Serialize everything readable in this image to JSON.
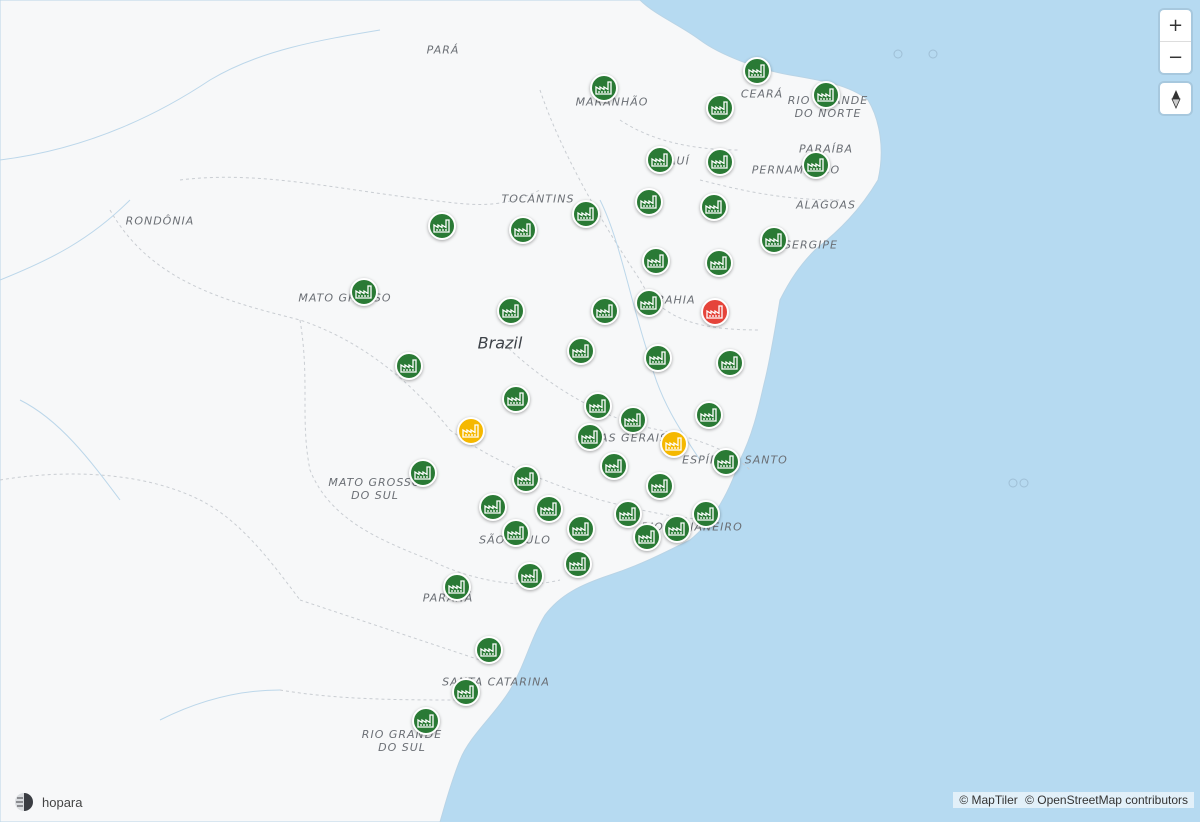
{
  "map": {
    "country_label": "Brazil",
    "region_labels": [
      {
        "text": "PARÁ"
      },
      {
        "text": "MARANHÃO"
      },
      {
        "text": "CEARÁ"
      },
      {
        "text": "RIO GRANDE\nDO NORTE"
      },
      {
        "text": "PARAÍBA"
      },
      {
        "text": "PERNAMBUCO"
      },
      {
        "text": "ALAGOAS"
      },
      {
        "text": "SERGIPE"
      },
      {
        "text": "TOCANTINS"
      },
      {
        "text": "RONDÔNIA"
      },
      {
        "text": "MATO GROSSO"
      },
      {
        "text": "BAHIA"
      },
      {
        "text": "MINAS GERAIS"
      },
      {
        "text": "ESPÍRITO SANTO"
      },
      {
        "text": "MATO GROSSO\nDO SUL"
      },
      {
        "text": "SÃO PAULO"
      },
      {
        "text": "RIO DE JANEIRO"
      },
      {
        "text": "PARANÁ"
      },
      {
        "text": "SANTA CATARINA"
      },
      {
        "text": "RIO GRANDE\nDO SUL"
      },
      {
        "text": "PIAUÍ"
      }
    ],
    "status_colors": {
      "green": "#2a7a35",
      "yellow": "#f5b800",
      "red": "#e5443a"
    },
    "marker_icon": "factory-icon"
  },
  "controls": {
    "zoom_in": "+",
    "zoom_out": "−",
    "compass_icon": "compass-icon"
  },
  "attribution": {
    "maptiler": "© MapTiler",
    "osm": "© OpenStreetMap contributors"
  },
  "logo": {
    "text": "hopara",
    "icon": "hopara-logo-icon"
  }
}
